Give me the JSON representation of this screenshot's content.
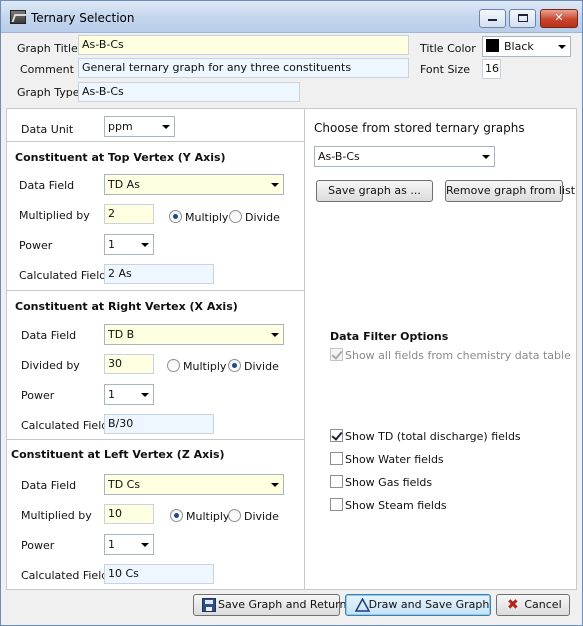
{
  "window": {
    "title": "Ternary Selection"
  },
  "header": {
    "graph_title_label": "Graph Title",
    "graph_title_value": "As-B-Cs",
    "title_color_label": "Title Color",
    "title_color_value": "Black",
    "comment_label": "Comment",
    "comment_value": "General ternary graph for any three constituents",
    "font_size_label": "Font Size",
    "font_size_value": "16",
    "graph_type_label": "Graph Type",
    "graph_type_value": "As-B-Cs"
  },
  "data_unit": {
    "label": "Data Unit",
    "value": "ppm"
  },
  "top": {
    "heading": "Constituent at Top Vertex (Y Axis)",
    "data_field_label": "Data Field",
    "data_field_value": "TD As",
    "factor_label": "Multiplied by",
    "factor_value": "2",
    "multiply_label": "Multiply",
    "divide_label": "Divide",
    "power_label": "Power",
    "power_value": "1",
    "calc_label": "Calculated Field",
    "calc_value": "2 As"
  },
  "right": {
    "heading": "Constituent at Right Vertex (X Axis)",
    "data_field_label": "Data Field",
    "data_field_value": "TD B",
    "factor_label": "Divided by",
    "factor_value": "30",
    "multiply_label": "Multiply",
    "divide_label": "Divide",
    "power_label": "Power",
    "power_value": "1",
    "calc_label": "Calculated Field",
    "calc_value": "B/30"
  },
  "left": {
    "heading": "Constituent at Left Vertex (Z Axis)",
    "data_field_label": "Data Field",
    "data_field_value": "TD Cs",
    "factor_label": "Multiplied by",
    "factor_value": "10",
    "multiply_label": "Multiply",
    "divide_label": "Divide",
    "power_label": "Power",
    "power_value": "1",
    "calc_label": "Calculated Field",
    "calc_value": "10 Cs"
  },
  "stored": {
    "heading": "Choose from stored ternary graphs",
    "selected": "As-B-Cs",
    "save_as_label": "Save graph as ...",
    "remove_label": "Remove graph from list"
  },
  "filter": {
    "heading": "Data Filter Options",
    "show_all_label": "Show all fields from chemistry data table",
    "show_td_label": "Show TD (total discharge) fields",
    "show_water_label": "Show Water fields",
    "show_gas_label": "Show Gas fields",
    "show_steam_label": "Show Steam fields"
  },
  "footer": {
    "save_return_label": "Save Graph and Return",
    "draw_save_label": "Draw and Save Graph",
    "cancel_label": "Cancel"
  },
  "colors": {
    "field_yellow": "#ffffe1",
    "field_blue": "#eef7ff",
    "title_swatch": "#000000"
  }
}
